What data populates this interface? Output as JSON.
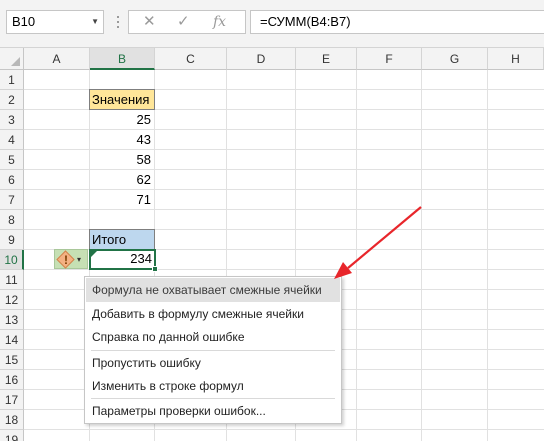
{
  "formula_bar": {
    "name_box": "B10",
    "cancel_glyph": "✕",
    "enter_glyph": "✓",
    "fx_glyph": "fx",
    "formula": "=СУММ(B4:B7)"
  },
  "columns": [
    "A",
    "B",
    "C",
    "D",
    "E",
    "F",
    "G",
    "H"
  ],
  "rows": [
    "1",
    "2",
    "3",
    "4",
    "5",
    "6",
    "7",
    "8",
    "9",
    "10",
    "11",
    "12",
    "13",
    "14",
    "15",
    "16",
    "17",
    "18",
    "19"
  ],
  "cells": {
    "B2": "Значения",
    "B3": "25",
    "B4": "43",
    "B5": "58",
    "B6": "62",
    "B7": "71",
    "B9": "Итого",
    "B10": "234"
  },
  "selection": {
    "active_cell": "B10",
    "column": "B",
    "row": "10"
  },
  "colors": {
    "accent": "#217346",
    "header_yellow": "#ffe699",
    "header_blue": "#bdd7ee",
    "arrow_red": "#e8262b"
  },
  "error_tag": {
    "icon": "warning-diamond-icon",
    "glyph": "!",
    "dropdown_glyph": "▾"
  },
  "context_menu": {
    "items": [
      "Формула не охватывает смежные ячейки",
      "Добавить в формулу смежные ячейки",
      "Справка по данной ошибке",
      "Пропустить ошибку",
      "Изменить в строке формул",
      "Параметры проверки ошибок..."
    ]
  }
}
